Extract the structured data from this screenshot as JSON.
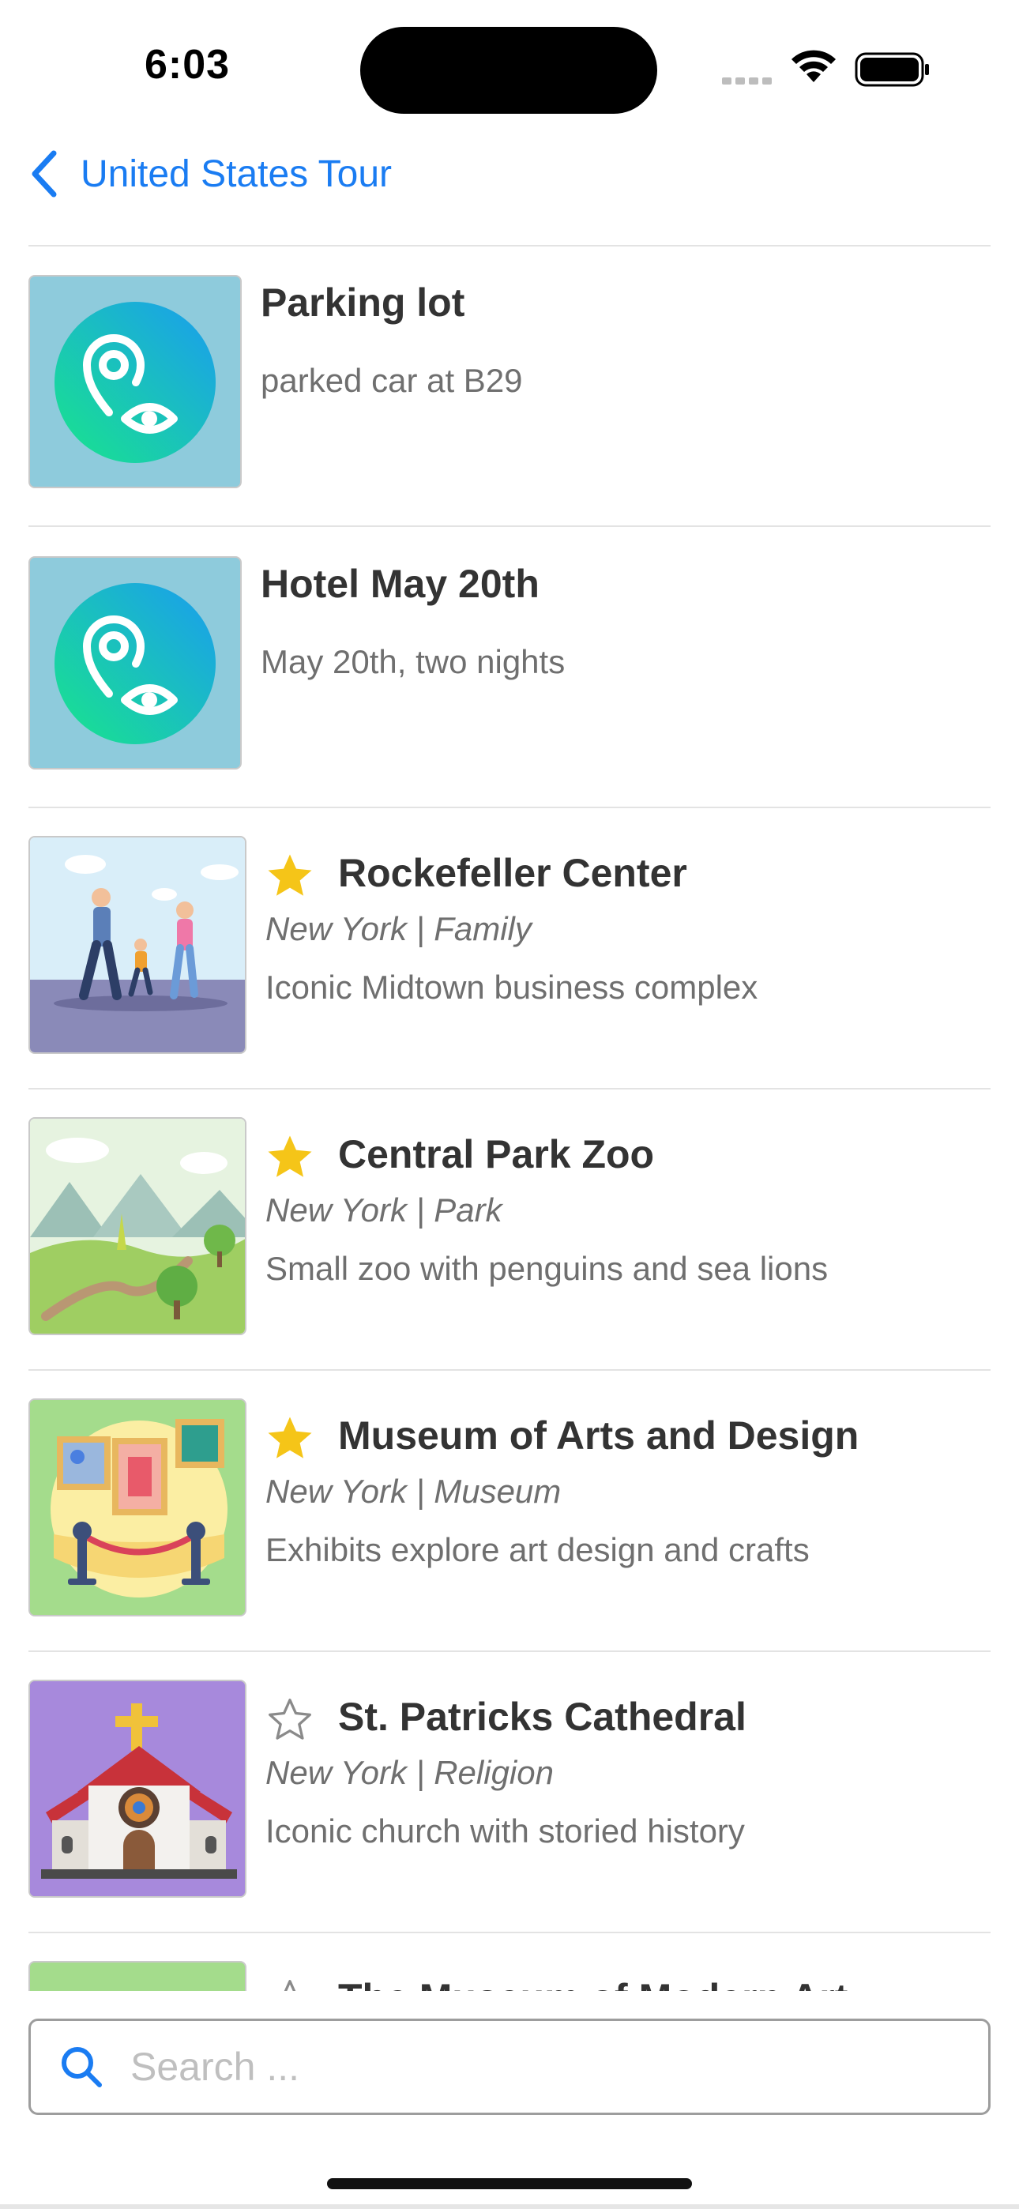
{
  "status_bar": {
    "time": "6:03"
  },
  "nav": {
    "back_label": "United States Tour"
  },
  "notes": [
    {
      "title": "Parking lot",
      "description": "parked car at B29",
      "icon": "location-eye-icon"
    },
    {
      "title": "Hotel May 20th",
      "description": "May 20th, two nights",
      "icon": "location-eye-icon"
    }
  ],
  "places": [
    {
      "favorite": true,
      "title": "Rockefeller Center",
      "subtitle": "New York | Family",
      "description": "Iconic Midtown business complex",
      "image": "family-walking-image"
    },
    {
      "favorite": true,
      "title": "Central Park Zoo",
      "subtitle": "New York | Park",
      "description": "Small zoo with penguins and sea lions",
      "image": "park-landscape-image"
    },
    {
      "favorite": true,
      "title": "Museum of Arts and Design",
      "subtitle": "New York | Museum",
      "description": "Exhibits explore art design and crafts",
      "image": "museum-gallery-image"
    },
    {
      "favorite": false,
      "title": "St. Patricks Cathedral",
      "subtitle": "New York | Religion",
      "description": "Iconic church with storied history",
      "image": "church-image"
    },
    {
      "favorite": false,
      "title": "The Museum of Modern Art",
      "subtitle": "",
      "description": "",
      "image": ""
    }
  ],
  "search": {
    "placeholder": "Search ..."
  },
  "colors": {
    "accent": "#1a7cf2",
    "star_filled": "#f5c518",
    "note_thumb_bg": "#8ecbdc",
    "divider": "#e3e3e3"
  }
}
